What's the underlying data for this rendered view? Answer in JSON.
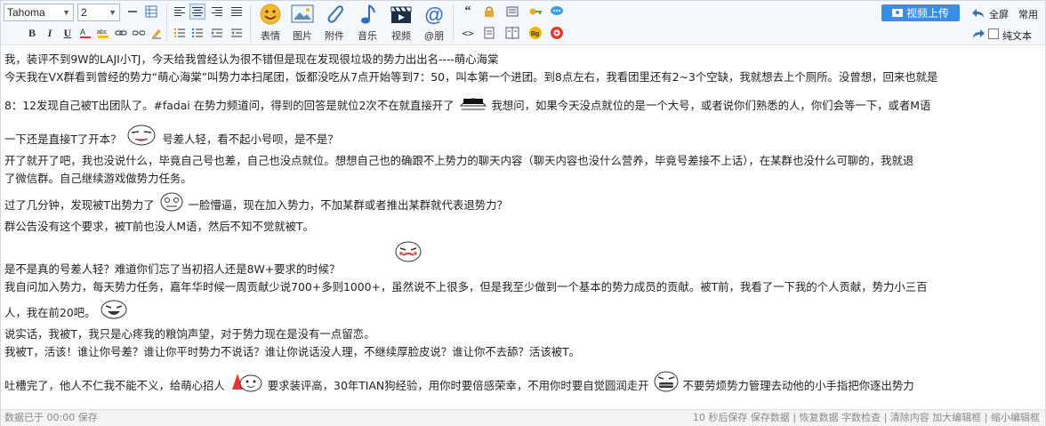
{
  "toolbar": {
    "font_family": "Tahoma",
    "font_size": "2",
    "big_buttons": [
      {
        "label": "表情"
      },
      {
        "label": "图片"
      },
      {
        "label": "附件"
      },
      {
        "label": "音乐"
      },
      {
        "label": "视频"
      },
      {
        "label": "@朋"
      }
    ],
    "upload_label": "视频上传",
    "fullscreen_label": "全屏",
    "common_label": "常用",
    "plaintext_label": "纯文本",
    "accent_color": "#3a8ee6"
  },
  "content": {
    "lines": [
      "我，装评不到9W的LAJI小TJ，今天给我曾经认为很不错但是现在发现很垃圾的势力出出名----萌心海棠",
      "今天我在VX群看到曾经的势力“萌心海棠”叫势力本扫尾团，饭都没吃从7点开始等到7：50，叫本第一个进团。到8点左右，我看团里还有2~3个空缺，我就想去上个厕所。没曾想，回来也就是",
      "8：12发现自己被T出团队了。#fadai 在势力频道问，得到的回答是就位2次不在就直接开了",
      "我想问，如果今天没点就位的是一个大号，或者说你们熟悉的人，你们会等一下，或者M语",
      "一下还是直接T了开本？",
      "号差人轻，看不起小号呗，是不是？",
      "开了就开了吧，我也没说什么，毕竟自己号也差，自己也没点就位。想想自己也的确跟不上势力的聊天内容（聊天内容也没什么营养，毕竟号差接不上话），在某群也没什么可聊的，我就退",
      "了微信群。自己继续游戏做势力任务。",
      "过了几分钟，发现被T出势力了",
      "一脸懵逼，现在加入势力，不加某群或者推出某群就代表退势力？",
      "群公告没有这个要求，被T前也没人M语，然后不知不觉就被T。",
      "是不是真的号差人轻？难道你们忘了当初招人还是8W+要求的时候？",
      "我自问加入势力，每天势力任务，嘉年华时候一周贡献少说700+多则1000+，虽然说不上很多，但是我至少做到一个基本的势力成员的贡献。被T前，我看了一下我的个人贡献，势力小三百",
      "人，我在前20吧。",
      "说实话，我被T，我只是心疼我的粮饷声望，对于势力现在是没有一点留恋。",
      "我被T，活该！谁让你号差？谁让你平时势力不说话？谁让你说话没人理，不继续厚脸皮说？谁让你不去舔？活该被T。",
      "吐槽完了，他人不仁我不能不义，给萌心招人",
      "要求装评高，30年TIAN狗经验，用你时要倍感荣幸，不用你时要自觉圆润走开",
      "不要劳烦势力管理去动他的小手指把你逐出势力"
    ]
  },
  "status": {
    "left": "数据已于 00:00 保存",
    "right": "10 秒后保存 保存数据 | 恢复数据    字数检查 | 清除内容    加大编辑框 | 缩小编辑框"
  }
}
